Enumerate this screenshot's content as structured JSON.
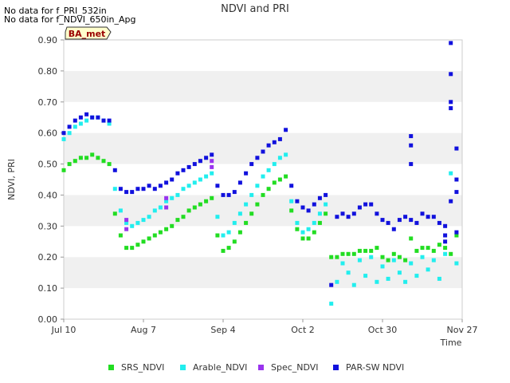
{
  "messages": [
    "No data for f_PRI_532in",
    "No data for f_NDVI_650in_Apg"
  ],
  "site_badge": "BA_met",
  "colors": {
    "SRS_NDVI": "#22dd22",
    "Arable_NDVI": "#22eeee",
    "Spec_NDVI": "#9933ee",
    "PAR-SW NDVI": "#1111dd",
    "band": "#f0f0f0",
    "badge_bg": "#ffffcc",
    "badge_text": "#990000"
  },
  "chart_data": {
    "type": "scatter",
    "title": "NDVI and PRI",
    "xlabel": "Time",
    "ylabel": "NDVI, PRI",
    "xlim": [
      "2024-07-10",
      "2024-11-27"
    ],
    "ylim": [
      0.0,
      0.9
    ],
    "x_ticks": [
      "Jul 10",
      "Aug 7",
      "Sep 4",
      "Oct 2",
      "Oct 30",
      "Nov 27"
    ],
    "y_ticks": [
      "0.00",
      "0.10",
      "0.20",
      "0.30",
      "0.40",
      "0.50",
      "0.60",
      "0.70",
      "0.80",
      "0.90"
    ],
    "legend_position": "bottom",
    "grid": "alternating horizontal bands",
    "series": [
      {
        "name": "SRS_NDVI",
        "points": [
          [
            "2024-07-10",
            0.48
          ],
          [
            "2024-07-12",
            0.5
          ],
          [
            "2024-07-14",
            0.51
          ],
          [
            "2024-07-16",
            0.52
          ],
          [
            "2024-07-18",
            0.52
          ],
          [
            "2024-07-20",
            0.53
          ],
          [
            "2024-07-22",
            0.52
          ],
          [
            "2024-07-24",
            0.51
          ],
          [
            "2024-07-26",
            0.5
          ],
          [
            "2024-07-28",
            0.34
          ],
          [
            "2024-07-30",
            0.27
          ],
          [
            "2024-08-01",
            0.23
          ],
          [
            "2024-08-03",
            0.23
          ],
          [
            "2024-08-05",
            0.24
          ],
          [
            "2024-08-07",
            0.25
          ],
          [
            "2024-08-09",
            0.26
          ],
          [
            "2024-08-11",
            0.27
          ],
          [
            "2024-08-13",
            0.28
          ],
          [
            "2024-08-15",
            0.29
          ],
          [
            "2024-08-17",
            0.3
          ],
          [
            "2024-08-19",
            0.32
          ],
          [
            "2024-08-21",
            0.33
          ],
          [
            "2024-08-23",
            0.35
          ],
          [
            "2024-08-25",
            0.36
          ],
          [
            "2024-08-27",
            0.37
          ],
          [
            "2024-08-29",
            0.38
          ],
          [
            "2024-08-31",
            0.39
          ],
          [
            "2024-09-02",
            0.27
          ],
          [
            "2024-09-04",
            0.22
          ],
          [
            "2024-09-06",
            0.23
          ],
          [
            "2024-09-08",
            0.25
          ],
          [
            "2024-09-10",
            0.28
          ],
          [
            "2024-09-12",
            0.31
          ],
          [
            "2024-09-14",
            0.34
          ],
          [
            "2024-09-16",
            0.37
          ],
          [
            "2024-09-18",
            0.4
          ],
          [
            "2024-09-20",
            0.42
          ],
          [
            "2024-09-22",
            0.44
          ],
          [
            "2024-09-24",
            0.45
          ],
          [
            "2024-09-26",
            0.46
          ],
          [
            "2024-09-28",
            0.35
          ],
          [
            "2024-09-30",
            0.29
          ],
          [
            "2024-10-02",
            0.26
          ],
          [
            "2024-10-04",
            0.26
          ],
          [
            "2024-10-06",
            0.28
          ],
          [
            "2024-10-08",
            0.31
          ],
          [
            "2024-10-10",
            0.34
          ],
          [
            "2024-10-12",
            0.2
          ],
          [
            "2024-10-14",
            0.2
          ],
          [
            "2024-10-16",
            0.21
          ],
          [
            "2024-10-18",
            0.21
          ],
          [
            "2024-10-20",
            0.21
          ],
          [
            "2024-10-22",
            0.22
          ],
          [
            "2024-10-24",
            0.22
          ],
          [
            "2024-10-26",
            0.22
          ],
          [
            "2024-10-28",
            0.23
          ],
          [
            "2024-10-30",
            0.2
          ],
          [
            "2024-11-01",
            0.19
          ],
          [
            "2024-11-03",
            0.21
          ],
          [
            "2024-11-05",
            0.2
          ],
          [
            "2024-11-07",
            0.19
          ],
          [
            "2024-11-09",
            0.26
          ],
          [
            "2024-11-11",
            0.22
          ],
          [
            "2024-11-13",
            0.23
          ],
          [
            "2024-11-15",
            0.23
          ],
          [
            "2024-11-17",
            0.22
          ],
          [
            "2024-11-19",
            0.24
          ],
          [
            "2024-11-21",
            0.23
          ],
          [
            "2024-11-23",
            0.21
          ],
          [
            "2024-11-25",
            0.27
          ]
        ]
      },
      {
        "name": "Arable_NDVI",
        "points": [
          [
            "2024-07-10",
            0.58
          ],
          [
            "2024-07-12",
            0.6
          ],
          [
            "2024-07-14",
            0.62
          ],
          [
            "2024-07-16",
            0.63
          ],
          [
            "2024-07-18",
            0.64
          ],
          [
            "2024-07-20",
            0.65
          ],
          [
            "2024-07-22",
            0.65
          ],
          [
            "2024-07-24",
            0.64
          ],
          [
            "2024-07-26",
            0.63
          ],
          [
            "2024-07-28",
            0.42
          ],
          [
            "2024-07-30",
            0.35
          ],
          [
            "2024-08-01",
            0.31
          ],
          [
            "2024-08-03",
            0.3
          ],
          [
            "2024-08-05",
            0.31
          ],
          [
            "2024-08-07",
            0.32
          ],
          [
            "2024-08-09",
            0.33
          ],
          [
            "2024-08-11",
            0.35
          ],
          [
            "2024-08-13",
            0.36
          ],
          [
            "2024-08-15",
            0.38
          ],
          [
            "2024-08-17",
            0.39
          ],
          [
            "2024-08-19",
            0.4
          ],
          [
            "2024-08-21",
            0.42
          ],
          [
            "2024-08-23",
            0.43
          ],
          [
            "2024-08-25",
            0.44
          ],
          [
            "2024-08-27",
            0.45
          ],
          [
            "2024-08-29",
            0.46
          ],
          [
            "2024-08-31",
            0.47
          ],
          [
            "2024-09-02",
            0.33
          ],
          [
            "2024-09-04",
            0.27
          ],
          [
            "2024-09-06",
            0.28
          ],
          [
            "2024-09-08",
            0.31
          ],
          [
            "2024-09-10",
            0.34
          ],
          [
            "2024-09-12",
            0.37
          ],
          [
            "2024-09-14",
            0.4
          ],
          [
            "2024-09-16",
            0.43
          ],
          [
            "2024-09-18",
            0.46
          ],
          [
            "2024-09-20",
            0.48
          ],
          [
            "2024-09-22",
            0.5
          ],
          [
            "2024-09-24",
            0.52
          ],
          [
            "2024-09-26",
            0.53
          ],
          [
            "2024-09-28",
            0.38
          ],
          [
            "2024-09-30",
            0.31
          ],
          [
            "2024-10-02",
            0.28
          ],
          [
            "2024-10-04",
            0.29
          ],
          [
            "2024-10-06",
            0.31
          ],
          [
            "2024-10-08",
            0.34
          ],
          [
            "2024-10-10",
            0.37
          ],
          [
            "2024-10-12",
            0.05
          ],
          [
            "2024-10-14",
            0.12
          ],
          [
            "2024-10-16",
            0.18
          ],
          [
            "2024-10-18",
            0.15
          ],
          [
            "2024-10-20",
            0.11
          ],
          [
            "2024-10-22",
            0.19
          ],
          [
            "2024-10-24",
            0.14
          ],
          [
            "2024-10-26",
            0.2
          ],
          [
            "2024-10-28",
            0.12
          ],
          [
            "2024-10-30",
            0.17
          ],
          [
            "2024-11-01",
            0.13
          ],
          [
            "2024-11-03",
            0.19
          ],
          [
            "2024-11-05",
            0.15
          ],
          [
            "2024-11-07",
            0.12
          ],
          [
            "2024-11-09",
            0.18
          ],
          [
            "2024-11-11",
            0.14
          ],
          [
            "2024-11-13",
            0.2
          ],
          [
            "2024-11-15",
            0.16
          ],
          [
            "2024-11-17",
            0.19
          ],
          [
            "2024-11-19",
            0.13
          ],
          [
            "2024-11-21",
            0.21
          ],
          [
            "2024-11-23",
            0.47
          ],
          [
            "2024-11-25",
            0.18
          ]
        ]
      },
      {
        "name": "Spec_NDVI",
        "points": [
          [
            "2024-08-01",
            0.29
          ],
          [
            "2024-08-01",
            0.32
          ],
          [
            "2024-08-15",
            0.36
          ],
          [
            "2024-08-15",
            0.39
          ],
          [
            "2024-08-31",
            0.49
          ],
          [
            "2024-08-31",
            0.51
          ]
        ]
      },
      {
        "name": "PAR-SW NDVI",
        "points": [
          [
            "2024-07-10",
            0.6
          ],
          [
            "2024-07-12",
            0.62
          ],
          [
            "2024-07-14",
            0.64
          ],
          [
            "2024-07-16",
            0.65
          ],
          [
            "2024-07-18",
            0.66
          ],
          [
            "2024-07-20",
            0.65
          ],
          [
            "2024-07-22",
            0.65
          ],
          [
            "2024-07-24",
            0.64
          ],
          [
            "2024-07-26",
            0.64
          ],
          [
            "2024-07-28",
            0.48
          ],
          [
            "2024-07-30",
            0.42
          ],
          [
            "2024-08-01",
            0.41
          ],
          [
            "2024-08-03",
            0.41
          ],
          [
            "2024-08-05",
            0.42
          ],
          [
            "2024-08-07",
            0.42
          ],
          [
            "2024-08-09",
            0.43
          ],
          [
            "2024-08-11",
            0.42
          ],
          [
            "2024-08-13",
            0.43
          ],
          [
            "2024-08-15",
            0.44
          ],
          [
            "2024-08-17",
            0.45
          ],
          [
            "2024-08-19",
            0.47
          ],
          [
            "2024-08-21",
            0.48
          ],
          [
            "2024-08-23",
            0.49
          ],
          [
            "2024-08-25",
            0.5
          ],
          [
            "2024-08-27",
            0.51
          ],
          [
            "2024-08-29",
            0.52
          ],
          [
            "2024-08-31",
            0.53
          ],
          [
            "2024-09-02",
            0.43
          ],
          [
            "2024-09-04",
            0.4
          ],
          [
            "2024-09-06",
            0.4
          ],
          [
            "2024-09-08",
            0.41
          ],
          [
            "2024-09-10",
            0.44
          ],
          [
            "2024-09-12",
            0.47
          ],
          [
            "2024-09-14",
            0.5
          ],
          [
            "2024-09-16",
            0.52
          ],
          [
            "2024-09-18",
            0.54
          ],
          [
            "2024-09-20",
            0.56
          ],
          [
            "2024-09-22",
            0.57
          ],
          [
            "2024-09-24",
            0.58
          ],
          [
            "2024-09-26",
            0.61
          ],
          [
            "2024-09-28",
            0.43
          ],
          [
            "2024-09-30",
            0.38
          ],
          [
            "2024-10-02",
            0.36
          ],
          [
            "2024-10-04",
            0.35
          ],
          [
            "2024-10-06",
            0.37
          ],
          [
            "2024-10-08",
            0.39
          ],
          [
            "2024-10-10",
            0.4
          ],
          [
            "2024-10-12",
            0.11
          ],
          [
            "2024-10-14",
            0.33
          ],
          [
            "2024-10-16",
            0.34
          ],
          [
            "2024-10-18",
            0.33
          ],
          [
            "2024-10-20",
            0.34
          ],
          [
            "2024-10-22",
            0.36
          ],
          [
            "2024-10-24",
            0.37
          ],
          [
            "2024-10-26",
            0.37
          ],
          [
            "2024-10-28",
            0.34
          ],
          [
            "2024-10-30",
            0.32
          ],
          [
            "2024-11-01",
            0.31
          ],
          [
            "2024-11-03",
            0.29
          ],
          [
            "2024-11-05",
            0.32
          ],
          [
            "2024-11-07",
            0.33
          ],
          [
            "2024-11-09",
            0.32
          ],
          [
            "2024-11-11",
            0.31
          ],
          [
            "2024-11-13",
            0.34
          ],
          [
            "2024-11-15",
            0.33
          ],
          [
            "2024-11-17",
            0.33
          ],
          [
            "2024-11-19",
            0.31
          ],
          [
            "2024-11-21",
            0.3
          ],
          [
            "2024-11-23",
            0.38
          ],
          [
            "2024-11-25",
            0.28
          ],
          [
            "2024-11-09",
            0.59
          ],
          [
            "2024-11-09",
            0.56
          ],
          [
            "2024-11-09",
            0.5
          ],
          [
            "2024-11-23",
            0.89
          ],
          [
            "2024-11-23",
            0.79
          ],
          [
            "2024-11-23",
            0.7
          ],
          [
            "2024-11-23",
            0.68
          ],
          [
            "2024-11-25",
            0.55
          ],
          [
            "2024-11-25",
            0.45
          ],
          [
            "2024-11-25",
            0.41
          ],
          [
            "2024-11-21",
            0.27
          ],
          [
            "2024-11-21",
            0.25
          ]
        ]
      }
    ]
  }
}
